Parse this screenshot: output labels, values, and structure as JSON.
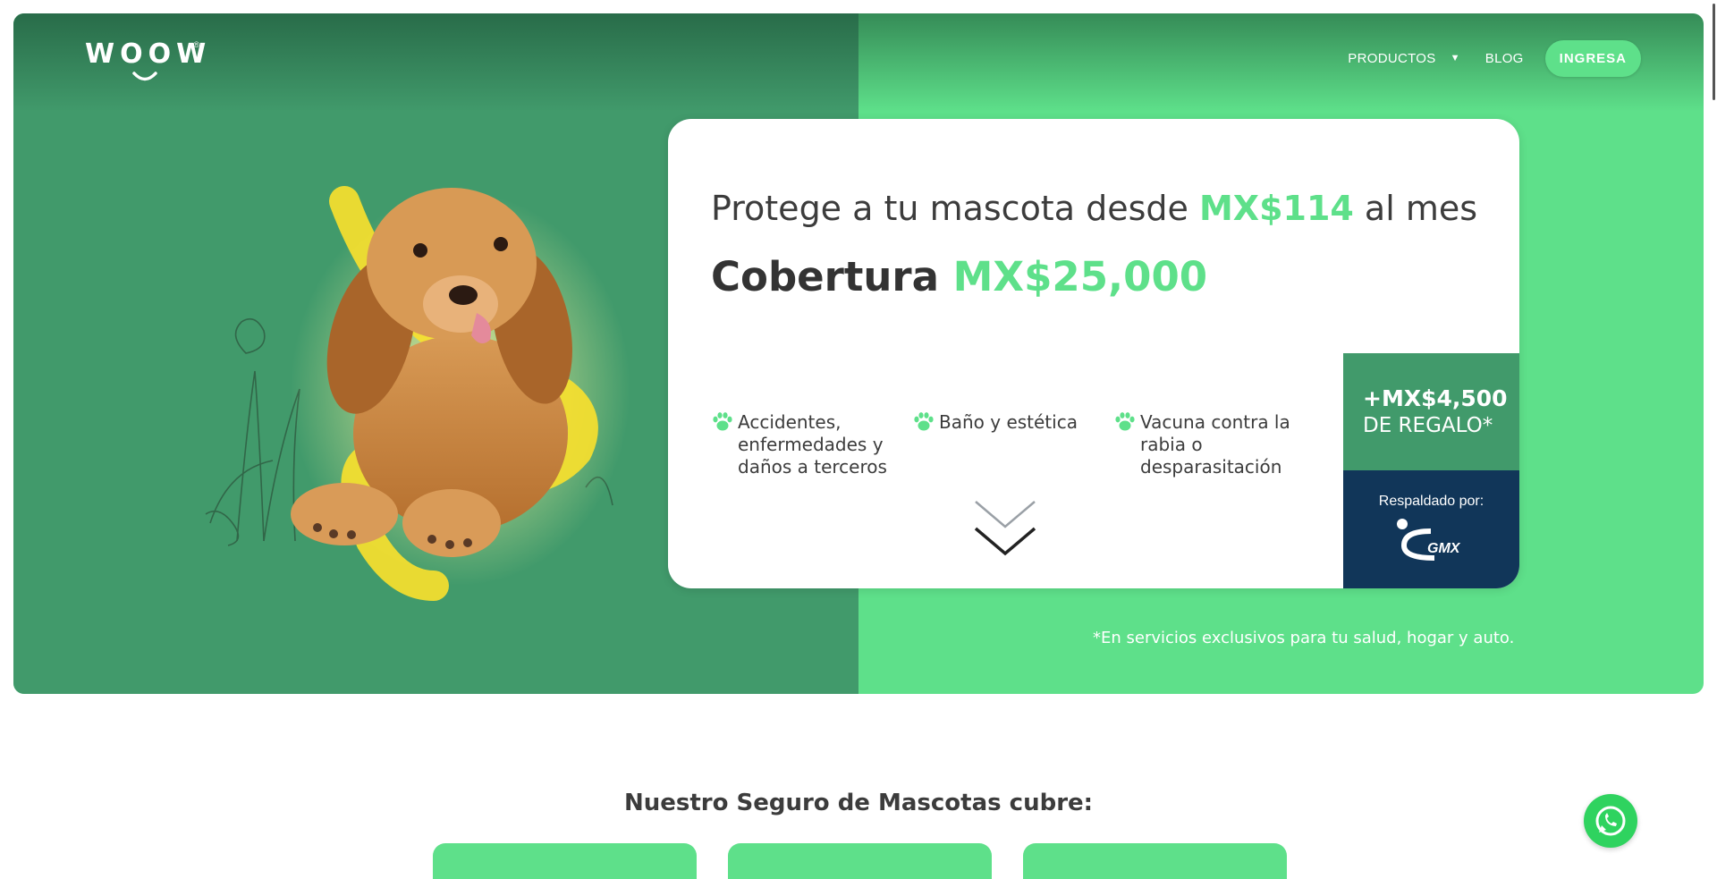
{
  "brand": {
    "logo_text": "WOOW",
    "registered_mark": "®"
  },
  "nav": {
    "items": [
      {
        "label": "PRODUCTOS",
        "has_dropdown": true
      },
      {
        "label": "BLOG",
        "has_dropdown": false
      }
    ],
    "login_label": "INGRESA"
  },
  "hero": {
    "line1_prefix": "Protege a tu mascota desde ",
    "line1_price": "MX$114",
    "line1_suffix": " al mes",
    "line2_prefix": "Cobertura ",
    "line2_amount": "MX$25,000",
    "benefits": [
      {
        "icon": "paw-icon",
        "text": "Accidentes, enfermedades y daños a terceros"
      },
      {
        "icon": "paw-icon",
        "text": "Baño y estética"
      },
      {
        "icon": "paw-icon",
        "text": "Vacuna contra la rabia o desparasitación"
      }
    ],
    "gift_amount": "+MX$4,500",
    "gift_label": "DE REGALO*",
    "backed_by_label": "Respaldado por:",
    "insurer_logo_text": "GMX",
    "footnote": "*En servicios exclusivos para tu salud, hogar y auto."
  },
  "coverage": {
    "title": "Nuestro Seguro de Mascotas cubre:"
  },
  "colors": {
    "accent_green": "#5ee08a",
    "dark_green": "#419a6b",
    "navy": "#113659",
    "text": "#3c3c3c"
  }
}
